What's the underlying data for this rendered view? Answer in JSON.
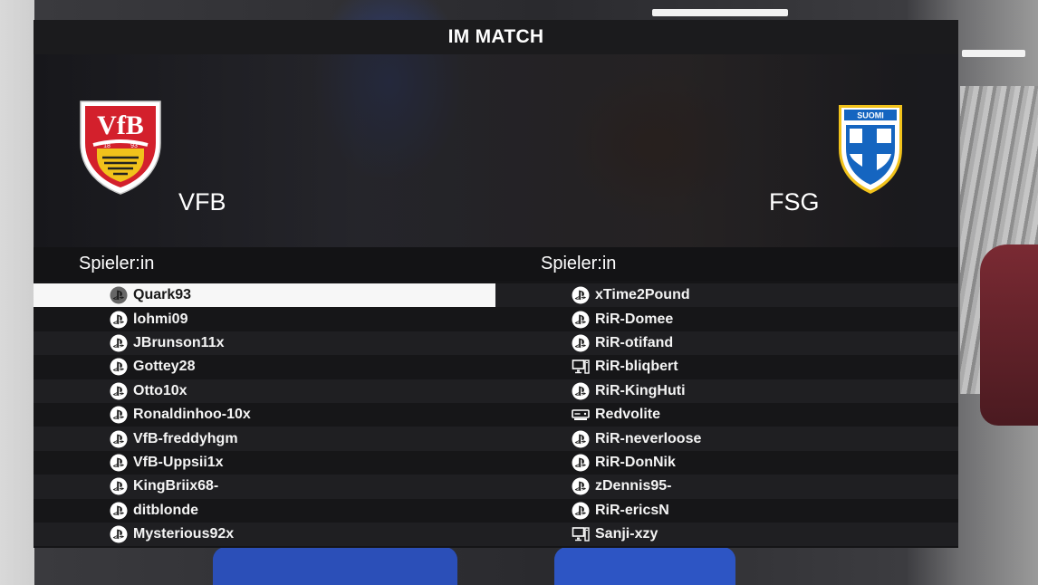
{
  "header": {
    "title": "IM MATCH"
  },
  "home": {
    "name": "VFB",
    "crest_text": "VfB",
    "crest_years": [
      "18",
      "93"
    ],
    "list_title": "Spieler:in",
    "players": [
      {
        "name": "Quark93",
        "platform": "playstation-icon",
        "selected": true
      },
      {
        "name": "lohmi09",
        "platform": "playstation-icon"
      },
      {
        "name": "JBrunson11x",
        "platform": "playstation-icon"
      },
      {
        "name": "Gottey28",
        "platform": "playstation-icon"
      },
      {
        "name": "Otto10x",
        "platform": "playstation-icon"
      },
      {
        "name": "Ronaldinhoo-10x",
        "platform": "playstation-icon"
      },
      {
        "name": "VfB-freddyhgm",
        "platform": "playstation-icon"
      },
      {
        "name": "VfB-Uppsii1x",
        "platform": "playstation-icon"
      },
      {
        "name": "KingBriix68-",
        "platform": "playstation-icon"
      },
      {
        "name": "ditblonde",
        "platform": "playstation-icon"
      },
      {
        "name": "Mysterious92x",
        "platform": "playstation-icon"
      }
    ]
  },
  "away": {
    "name": "FSG",
    "crest_text": "SUOMI",
    "list_title": "Spieler:in",
    "players": [
      {
        "name": "xTime2Pound",
        "platform": "playstation-icon"
      },
      {
        "name": "RiR-Domee",
        "platform": "playstation-icon"
      },
      {
        "name": "RiR-otifand",
        "platform": "playstation-icon"
      },
      {
        "name": "RiR-bliqbert",
        "platform": "pc-icon"
      },
      {
        "name": "RiR-KingHuti",
        "platform": "playstation-icon"
      },
      {
        "name": "Redvolite",
        "platform": "xbox-icon"
      },
      {
        "name": "RiR-neverloose",
        "platform": "playstation-icon"
      },
      {
        "name": "RiR-DonNik",
        "platform": "playstation-icon"
      },
      {
        "name": "zDennis95-",
        "platform": "playstation-icon"
      },
      {
        "name": "RiR-ericsN",
        "platform": "playstation-icon"
      },
      {
        "name": "Sanji-xzy",
        "platform": "pc-icon"
      }
    ]
  },
  "colors": {
    "panel": "#1b1b1d",
    "selected_row": "#f7f7f7",
    "vfb_red": "#d3202c",
    "vfb_gold": "#f1c21b",
    "finland_blue": "#1565c0"
  }
}
